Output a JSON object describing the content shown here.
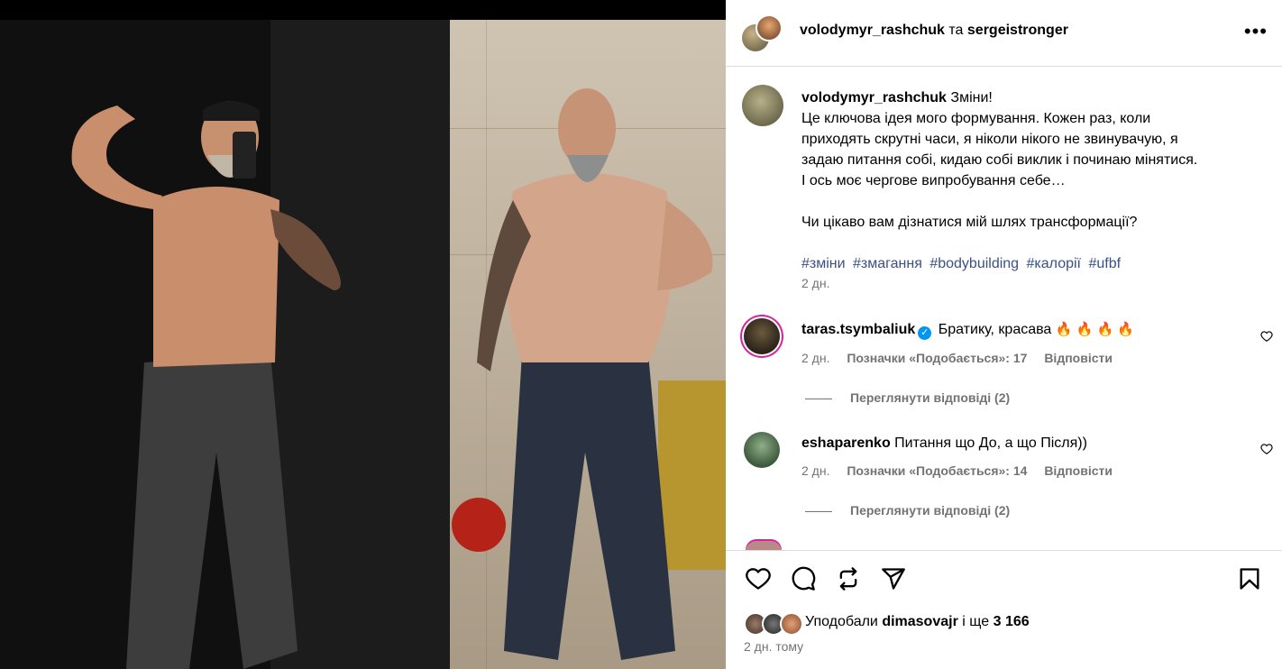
{
  "header": {
    "user1": "volodymyr_rashchuk",
    "connector": "та",
    "user2": "sergeistronger",
    "more_icon": "more-horizontal-icon"
  },
  "caption": {
    "username": "volodymyr_rashchuk",
    "lines": [
      "Зміни!",
      "Це ключова ідея мого формування. Кожен раз, коли",
      "приходять скрутні часи, я ніколи нікого не звинувачую, я",
      "задаю питання собі, кидаю собі виклик і починаю мінятися.",
      "І ось моє чергове випробування себе…",
      "Чи цікаво вам дізнатися мій шлях трансформації?"
    ],
    "hashtags": [
      "#зміни",
      "#змагання",
      "#bodybuilding",
      "#калорії",
      "#ufbf"
    ],
    "time": "2 дн."
  },
  "comments": [
    {
      "username": "taras.tsymbaliuk",
      "verified": true,
      "text": "Братику, красава",
      "emoji": "🔥 🔥 🔥 🔥",
      "time": "2 дн.",
      "likes": "Позначки «Подобається»: 17",
      "reply": "Відповісти",
      "view_replies": "Переглянути відповіді (2)"
    },
    {
      "username": "eshaparenko",
      "verified": false,
      "text": "Питання що До, а що Після))",
      "time": "2 дн.",
      "likes": "Позначки «Подобається»: 14",
      "reply": "Відповісти",
      "view_replies": "Переглянути відповіді (2)"
    }
  ],
  "actions": {
    "icons": [
      "heart-icon",
      "comment-icon",
      "repost-icon",
      "share-icon",
      "bookmark-icon"
    ],
    "liked_prefix": "Уподобали",
    "liked_user": "dimasovajr",
    "liked_suffix": "і ще",
    "liked_count": "3 166",
    "post_time": "2 дн. тому"
  },
  "colors": {
    "hashtag": "#385185",
    "verified": "#0095f6",
    "muted": "#737373",
    "border": "#dbdbdb"
  }
}
